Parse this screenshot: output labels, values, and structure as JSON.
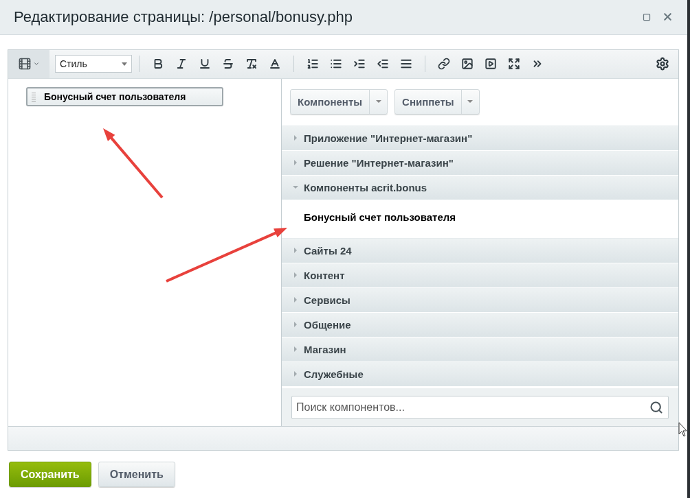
{
  "window": {
    "title": "Редактирование страницы: /personal/bonusy.php"
  },
  "toolbar": {
    "style_select": "Стиль"
  },
  "editor": {
    "blocks": [
      {
        "label": "Бонусный счет пользователя"
      }
    ]
  },
  "panel": {
    "buttons": [
      {
        "label": "Компоненты"
      },
      {
        "label": "Сниппеты"
      }
    ],
    "sections": [
      {
        "label": "Приложение \"Интернет-магазин\"",
        "expanded": false
      },
      {
        "label": "Решение \"Интернет-магазин\"",
        "expanded": false
      },
      {
        "label": "Компоненты acrit.bonus",
        "expanded": true,
        "children": [
          {
            "label": "Бонусный счет пользователя"
          }
        ]
      },
      {
        "label": "Сайты 24",
        "expanded": false
      },
      {
        "label": "Контент",
        "expanded": false
      },
      {
        "label": "Сервисы",
        "expanded": false
      },
      {
        "label": "Общение",
        "expanded": false
      },
      {
        "label": "Магазин",
        "expanded": false
      },
      {
        "label": "Служебные",
        "expanded": false
      }
    ],
    "search": {
      "placeholder": "Поиск компонентов..."
    }
  },
  "footer": {
    "buttons": [
      {
        "label": "Сохранить",
        "kind": "primary"
      },
      {
        "label": "Отменить",
        "kind": "secondary"
      }
    ]
  }
}
